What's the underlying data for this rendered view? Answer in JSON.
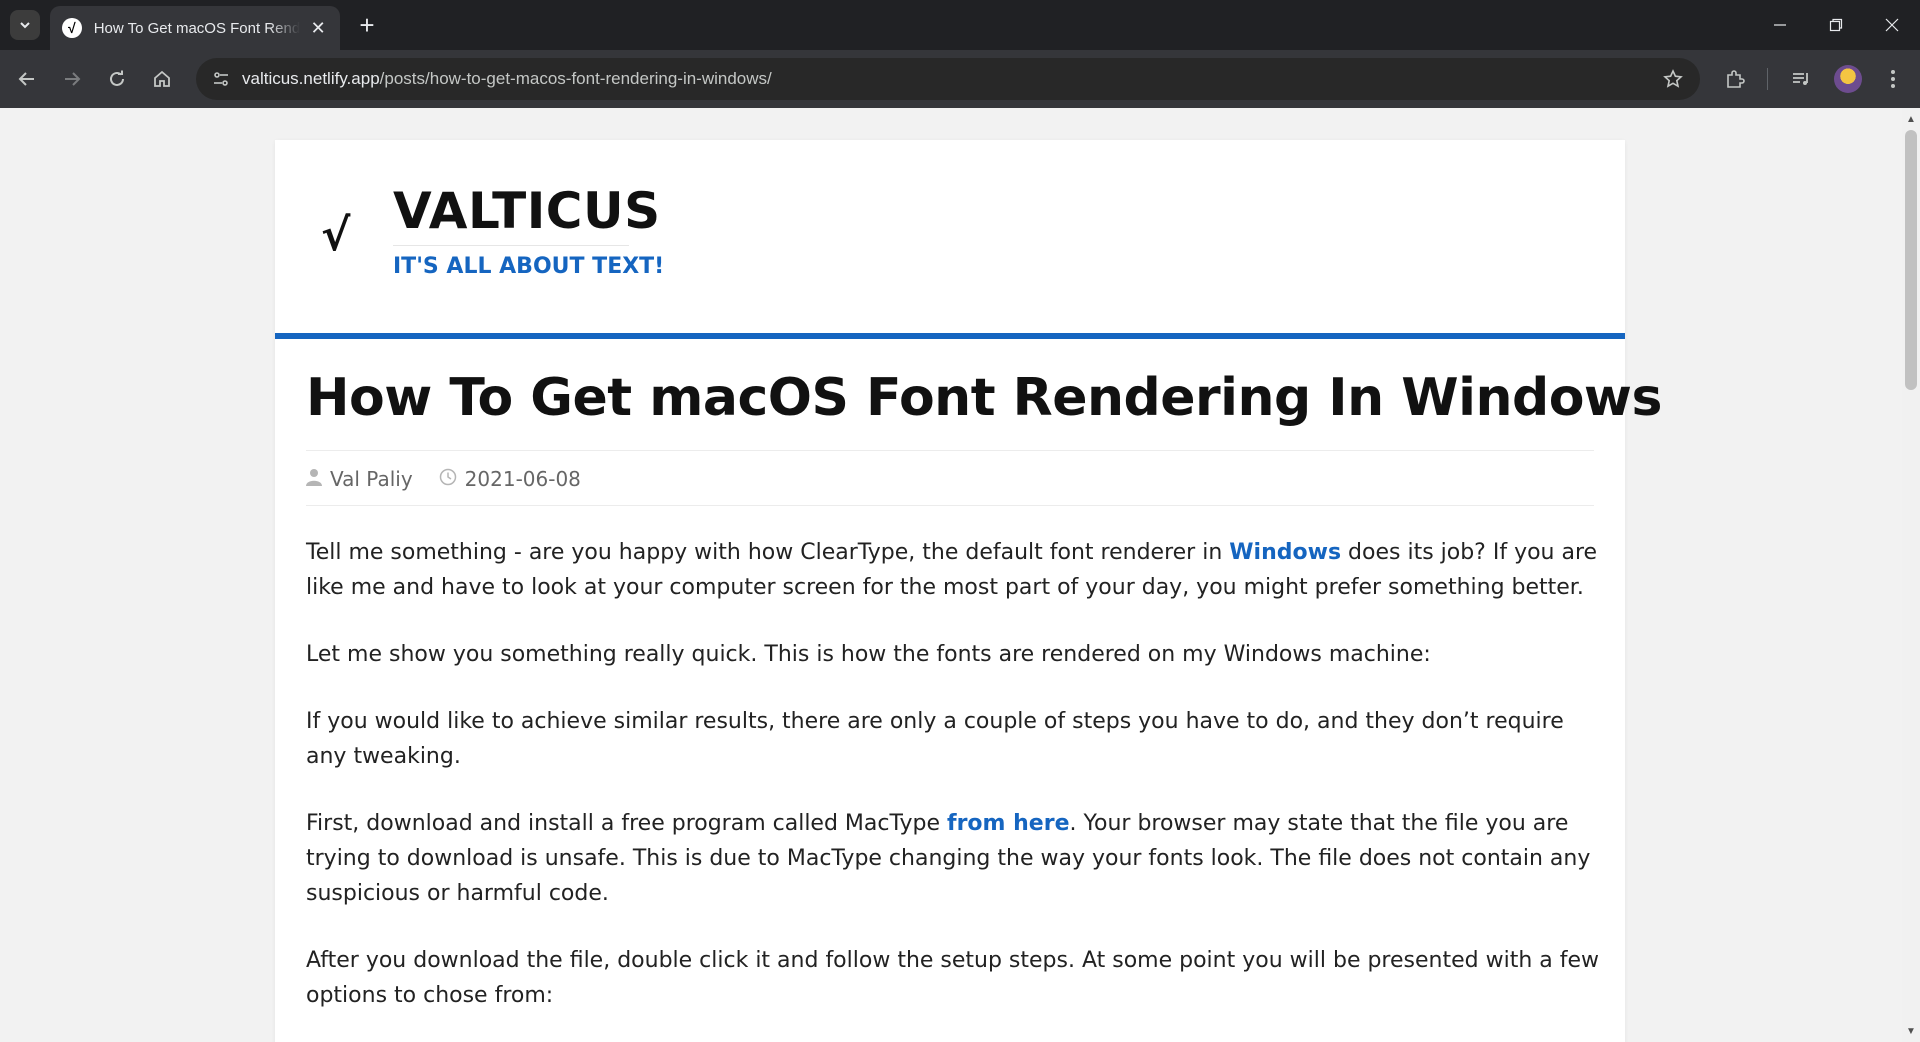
{
  "browser": {
    "tab_title": "How To Get macOS Font Rendering In Windows",
    "tab_favicon": "√",
    "url_host": "valticus.netlify.app",
    "url_path": "/posts/how-to-get-macos-font-rendering-in-windows/"
  },
  "site": {
    "logo": "√",
    "title": "VALTICUS",
    "tagline": "IT'S ALL ABOUT TEXT!"
  },
  "post": {
    "title": "How To Get macOS Font Rendering In Windows",
    "author": "Val Paliy",
    "date": "2021-06-08",
    "p1_before": "Tell me something - are you happy with how ClearType, the default font renderer in ",
    "p1_link": "Windows",
    "p1_after": " does its job? If you are like me and have to look at your computer screen for the most part of your day, you might prefer something better.",
    "p2": "Let me show you something really quick. This is how the fonts are rendered on my Windows machine:",
    "p3": "If you would like to achieve similar results, there are only a couple of steps you have to do, and they don’t require any tweaking.",
    "p4_before": "First, download and install a free program called MacType ",
    "p4_link": "from here",
    "p4_after": ". Your browser may state that the file you are trying to download is unsafe. This is due to MacType changing the way your fonts look. The file does not contain any suspicious or harmful code.",
    "p5": "After you download the file, double click it and follow the setup steps. At some point you will be presented with a few options to chose from:"
  },
  "colors": {
    "accent": "#1565c0",
    "chrome_bg": "#202124",
    "toolbar_bg": "#35363a"
  }
}
